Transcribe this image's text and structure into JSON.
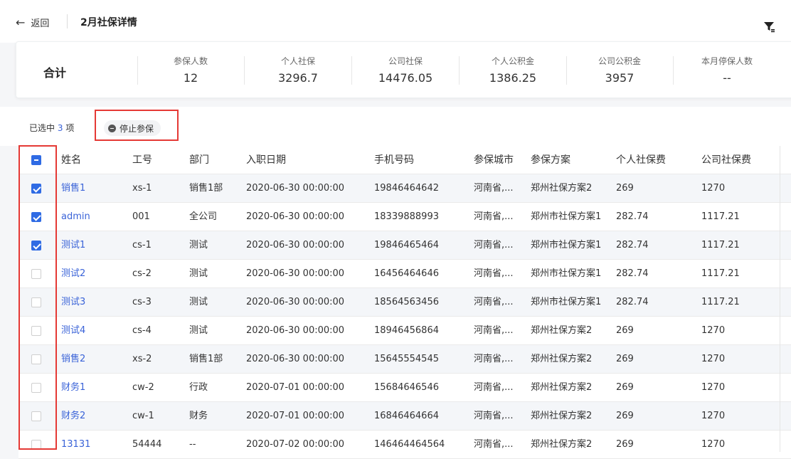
{
  "header": {
    "back_label": "返回",
    "title": "2月社保详情"
  },
  "summary": {
    "label": "合计",
    "cols": [
      {
        "key": "参保人数",
        "value": "12"
      },
      {
        "key": "个人社保",
        "value": "3296.7"
      },
      {
        "key": "公司社保",
        "value": "14476.05"
      },
      {
        "key": "个人公积金",
        "value": "1386.25"
      },
      {
        "key": "公司公积金",
        "value": "3957"
      },
      {
        "key": "本月停保人数",
        "value": "--"
      }
    ]
  },
  "toolbar": {
    "selected_prefix": "已选中",
    "selected_count": "3",
    "selected_suffix": "项",
    "stop_label": "停止参保"
  },
  "table": {
    "headers": [
      "姓名",
      "工号",
      "部门",
      "入职日期",
      "手机号码",
      "参保城市",
      "参保方案",
      "个人社保费",
      "公司社保费"
    ],
    "rows": [
      {
        "checked": true,
        "name": "销售1",
        "id": "xs-1",
        "dept": "销售1部",
        "date": "2020-06-30 00:00:00",
        "phone": "19846464642",
        "city": "河南省,...",
        "plan": "郑州社保方案2",
        "personal": "269",
        "company": "1270"
      },
      {
        "checked": true,
        "name": "admin",
        "id": "001",
        "dept": "全公司",
        "date": "2020-06-30 00:00:00",
        "phone": "18339888993",
        "city": "河南省,...",
        "plan": "郑州市社保方案1",
        "personal": "282.74",
        "company": "1117.21"
      },
      {
        "checked": true,
        "name": "测试1",
        "id": "cs-1",
        "dept": "测试",
        "date": "2020-06-30 00:00:00",
        "phone": "19846465464",
        "city": "河南省,...",
        "plan": "郑州市社保方案1",
        "personal": "282.74",
        "company": "1117.21"
      },
      {
        "checked": false,
        "name": "测试2",
        "id": "cs-2",
        "dept": "测试",
        "date": "2020-06-30 00:00:00",
        "phone": "16456464646",
        "city": "河南省,...",
        "plan": "郑州市社保方案1",
        "personal": "282.74",
        "company": "1117.21"
      },
      {
        "checked": false,
        "name": "测试3",
        "id": "cs-3",
        "dept": "测试",
        "date": "2020-06-30 00:00:00",
        "phone": "18564563456",
        "city": "河南省,...",
        "plan": "郑州市社保方案1",
        "personal": "282.74",
        "company": "1117.21"
      },
      {
        "checked": false,
        "name": "测试4",
        "id": "cs-4",
        "dept": "测试",
        "date": "2020-06-30 00:00:00",
        "phone": "18946456864",
        "city": "河南省,...",
        "plan": "郑州社保方案2",
        "personal": "269",
        "company": "1270"
      },
      {
        "checked": false,
        "name": "销售2",
        "id": "xs-2",
        "dept": "销售1部",
        "date": "2020-06-30 00:00:00",
        "phone": "15645554545",
        "city": "河南省,...",
        "plan": "郑州社保方案2",
        "personal": "269",
        "company": "1270"
      },
      {
        "checked": false,
        "name": "财务1",
        "id": "cw-2",
        "dept": "行政",
        "date": "2020-07-01 00:00:00",
        "phone": "15684646546",
        "city": "河南省,...",
        "plan": "郑州社保方案2",
        "personal": "269",
        "company": "1270"
      },
      {
        "checked": false,
        "name": "财务2",
        "id": "cw-1",
        "dept": "财务",
        "date": "2020-07-01 00:00:00",
        "phone": "16846464664",
        "city": "河南省,...",
        "plan": "郑州社保方案2",
        "personal": "269",
        "company": "1270"
      },
      {
        "checked": false,
        "name": "13131",
        "id": "54444",
        "dept": "--",
        "date": "2020-07-02 00:00:00",
        "phone": "146464464564",
        "city": "河南省,...",
        "plan": "郑州社保方案2",
        "personal": "269",
        "company": "1270"
      }
    ]
  },
  "icons": {
    "back": "arrow-left-icon",
    "filter": "filter-icon",
    "stop": "minus-circle-icon"
  },
  "colors": {
    "accent": "#2f6be4",
    "link": "#3a63d8",
    "highlight": "#e53935"
  }
}
